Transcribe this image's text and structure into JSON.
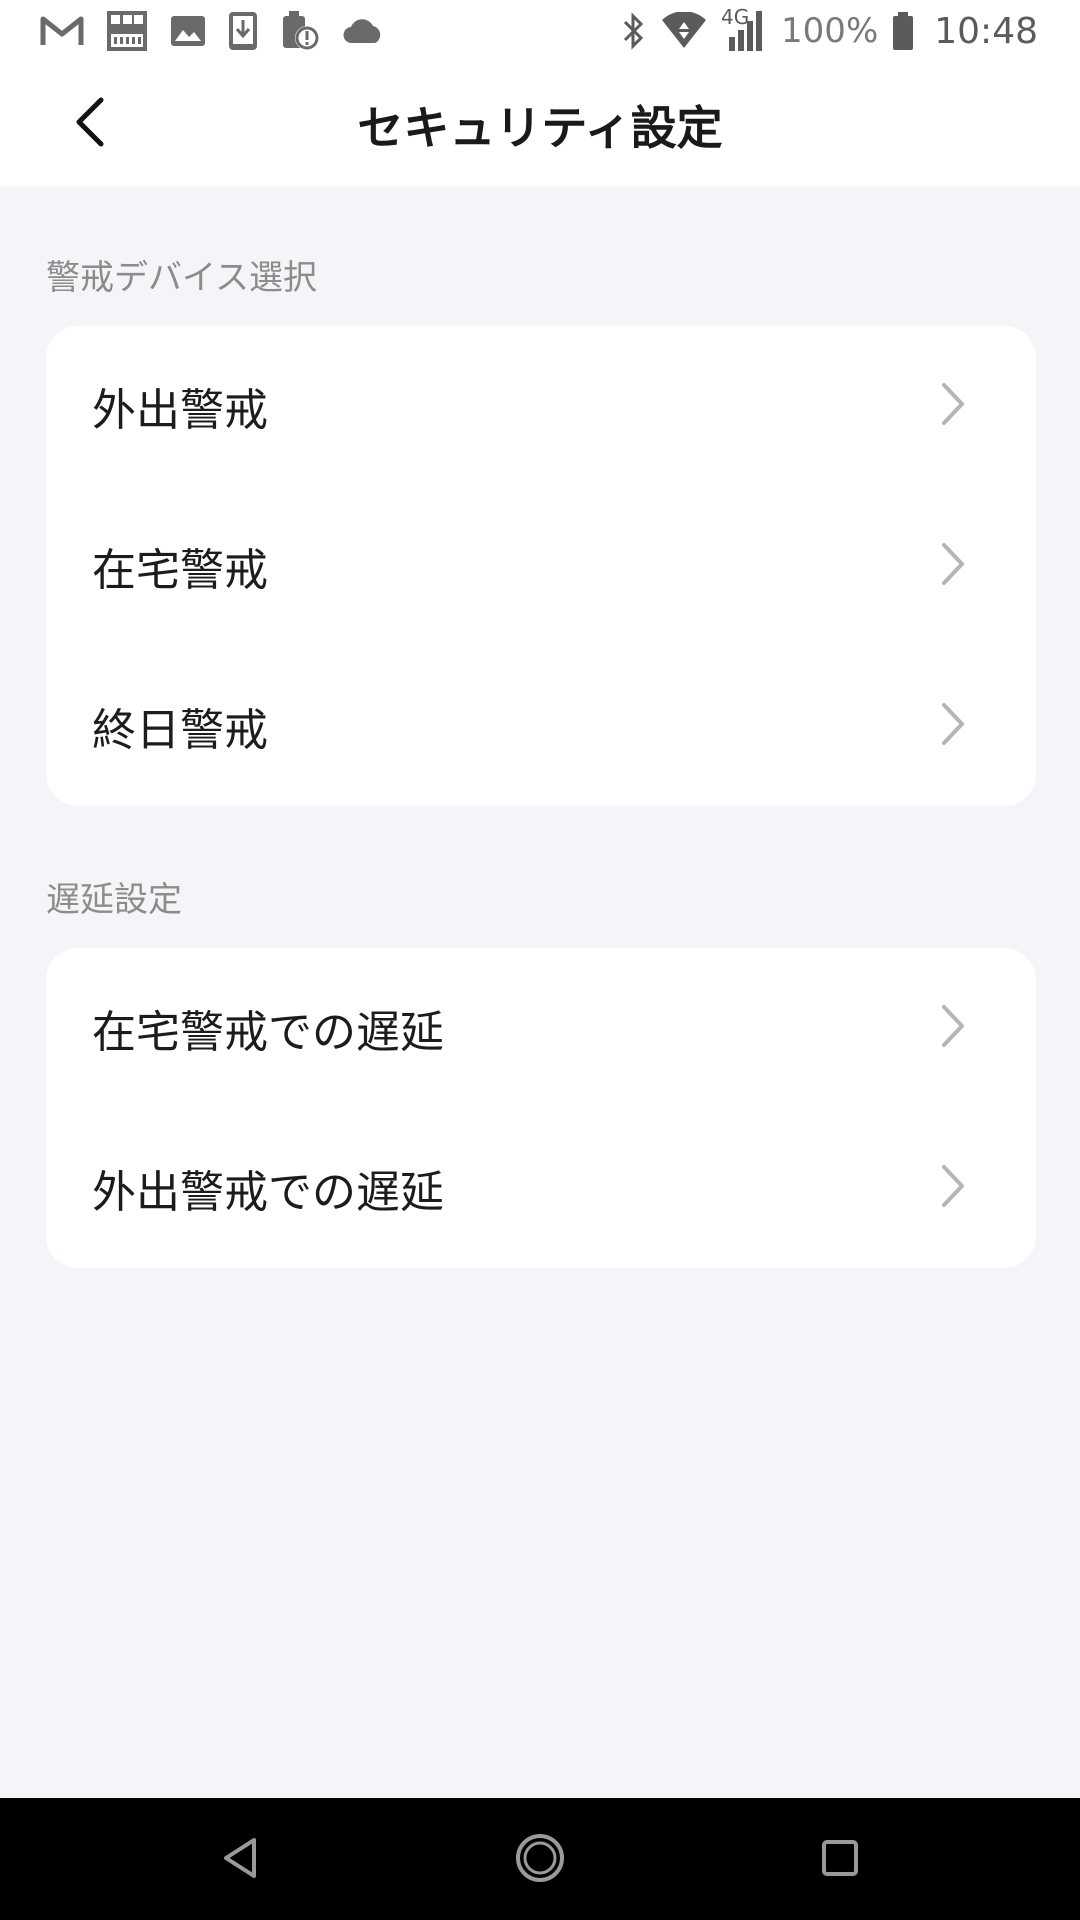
{
  "status_bar": {
    "left_icons": [
      "gmail-icon",
      "qr-code-icon",
      "image-icon",
      "download-icon",
      "storage-warning-icon",
      "cloud-icon"
    ],
    "right_icons": [
      "bluetooth-icon",
      "wifi-icon",
      "signal-4g-icon",
      "battery-icon"
    ],
    "network_label": "4G",
    "battery": "100%",
    "time": "10:48"
  },
  "header": {
    "title": "セキュリティ設定"
  },
  "sections": [
    {
      "label": "警戒デバイス選択",
      "items": [
        {
          "label": "外出警戒"
        },
        {
          "label": "在宅警戒"
        },
        {
          "label": "終日警戒"
        }
      ]
    },
    {
      "label": "遅延設定",
      "items": [
        {
          "label": "在宅警戒での遅延"
        },
        {
          "label": "外出警戒での遅延"
        }
      ]
    }
  ],
  "nav_bar": {
    "buttons": [
      "back-triangle-icon",
      "home-circle-icon",
      "recents-square-icon"
    ]
  },
  "colors": {
    "background": "#f4f5f9",
    "card": "#ffffff",
    "section_label": "#8c8c8c",
    "chevron": "#b5b5b5",
    "nav_bar": "#000000"
  }
}
